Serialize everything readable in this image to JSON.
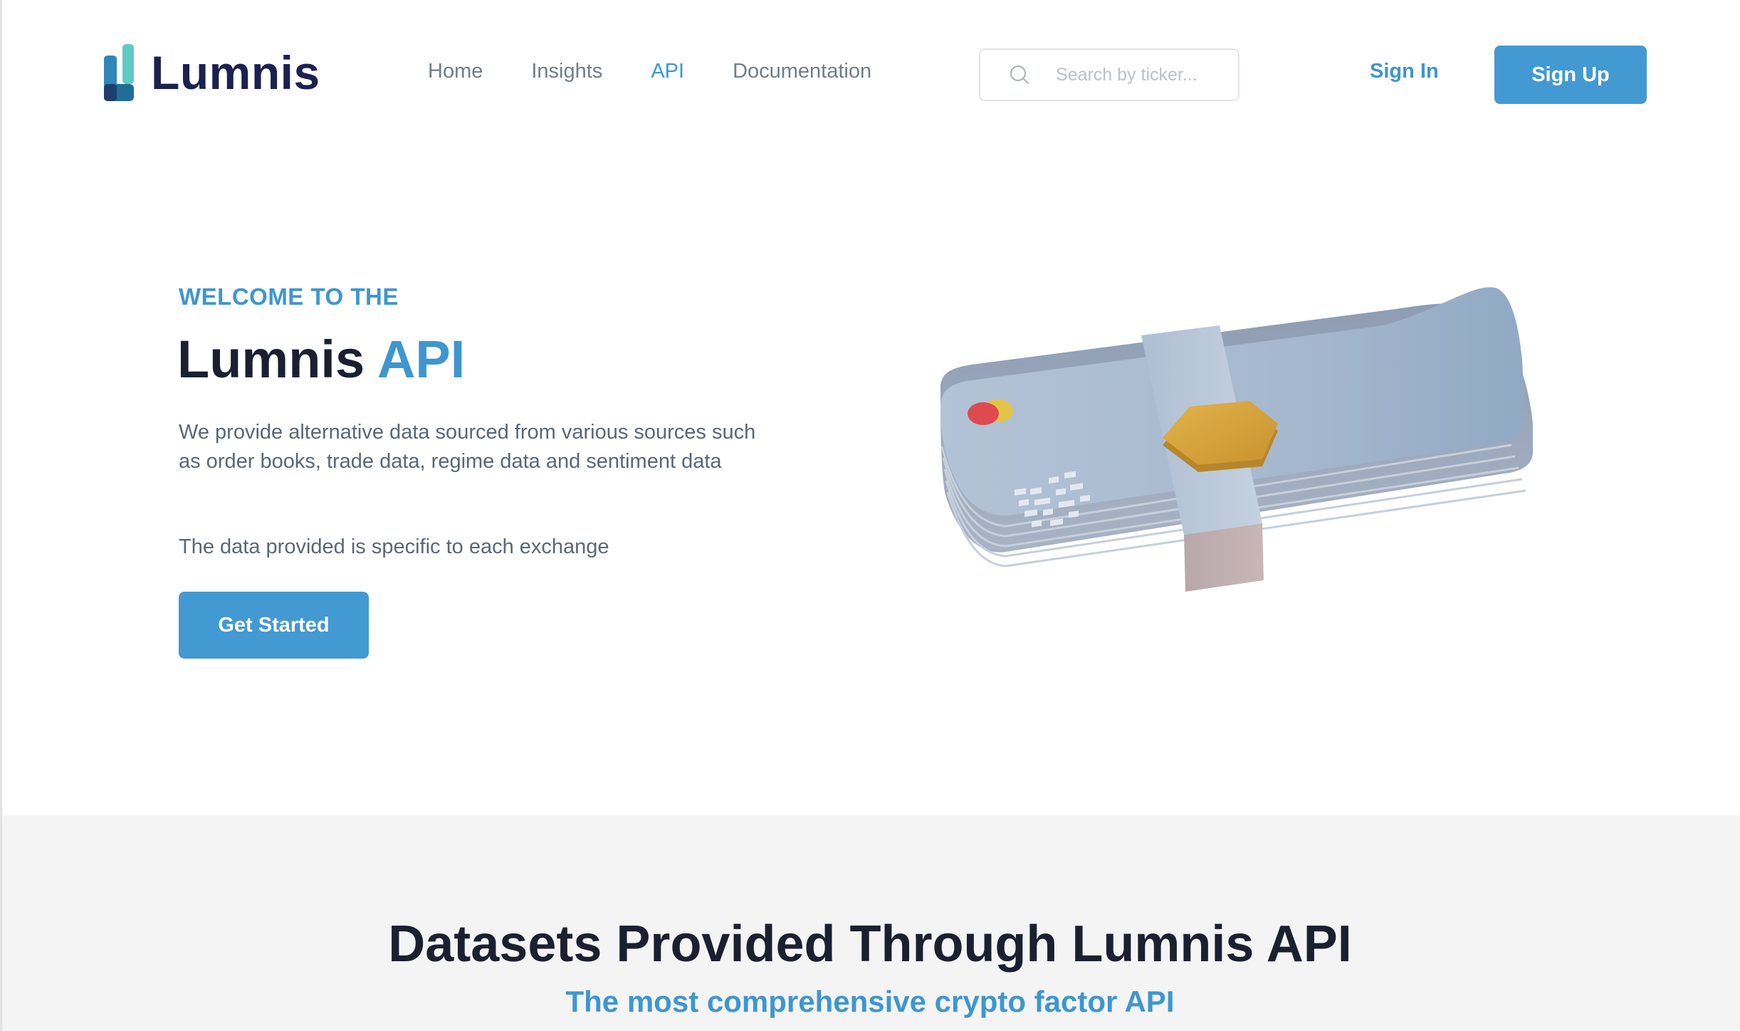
{
  "brand": {
    "name": "Lumnis",
    "color": "#1b2150",
    "accent_color": "#3e96cf"
  },
  "nav": {
    "links": [
      {
        "label": "Home",
        "active": false
      },
      {
        "label": "Insights",
        "active": false
      },
      {
        "label": "API",
        "active": true
      },
      {
        "label": "Documentation",
        "active": false
      }
    ],
    "search": {
      "placeholder": "Search by ticker...",
      "value": "",
      "icon": "search-icon"
    },
    "sign_in_label": "Sign In",
    "sign_up_label": "Sign Up"
  },
  "hero": {
    "eyebrow": "WELCOME TO THE",
    "title_main": "Lumnis",
    "title_accent": "API",
    "description": "We provide alternative data sourced from various sources such as order books, trade data, regime data and sentiment data",
    "note": "The data provided is specific to each exchange",
    "cta_label": "Get Started",
    "illustration": "stacked-cards-illustration"
  },
  "datasets": {
    "title": "Datasets Provided Through Lumnis API",
    "subtitle": "The most comprehensive crypto factor API"
  }
}
